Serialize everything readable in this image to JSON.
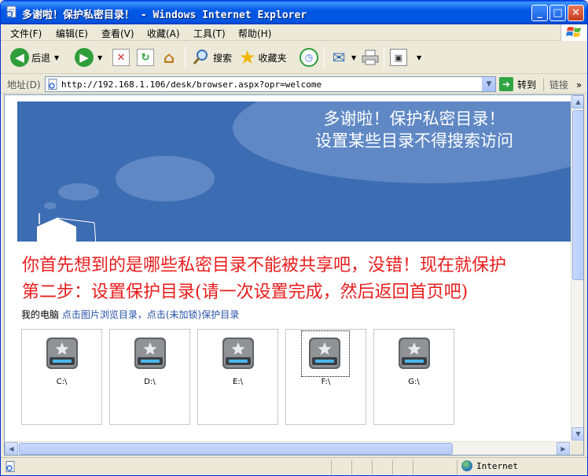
{
  "window": {
    "title": "多谢啦！保护私密目录！ - Windows Internet Explorer",
    "title_colors": {
      "bar": "#0058e6",
      "close": "#c53c1c"
    }
  },
  "menu": [
    "文件(F)",
    "编辑(E)",
    "查看(V)",
    "收藏(A)",
    "工具(T)",
    "帮助(H)"
  ],
  "toolbar": {
    "back_label": "后退",
    "search_label": "搜索",
    "favorites_label": "收藏夹"
  },
  "address": {
    "label": "地址(D)",
    "url": "http://192.168.1.106/desk/browser.aspx?opr=welcome",
    "go_label": "转到",
    "links_label": "链接",
    "links_more": "»"
  },
  "page": {
    "banner_line1": "多谢啦！保护私密目录！",
    "banner_line2": "设置某些目录不得搜索访问",
    "intro_line1": "你首先想到的是哪些私密目录不能被共享吧，没错！现在就保护",
    "intro_line2": "第二步：设置保护目录(请一次设置完成，然后返回首页吧)",
    "my_computer": "我的电脑",
    "hint": "点击图片浏览目录，点击(未加锁)保护目录",
    "drives": [
      {
        "label": "C:\\",
        "selected": false
      },
      {
        "label": "D:\\",
        "selected": false
      },
      {
        "label": "E:\\",
        "selected": false
      },
      {
        "label": "F:\\",
        "selected": true
      },
      {
        "label": "G:\\",
        "selected": false
      }
    ],
    "colors": {
      "banner": "#3c6cb2",
      "intro_text": "#e81d1d",
      "link": "#2451a6"
    }
  },
  "status": {
    "zone": "Internet"
  }
}
